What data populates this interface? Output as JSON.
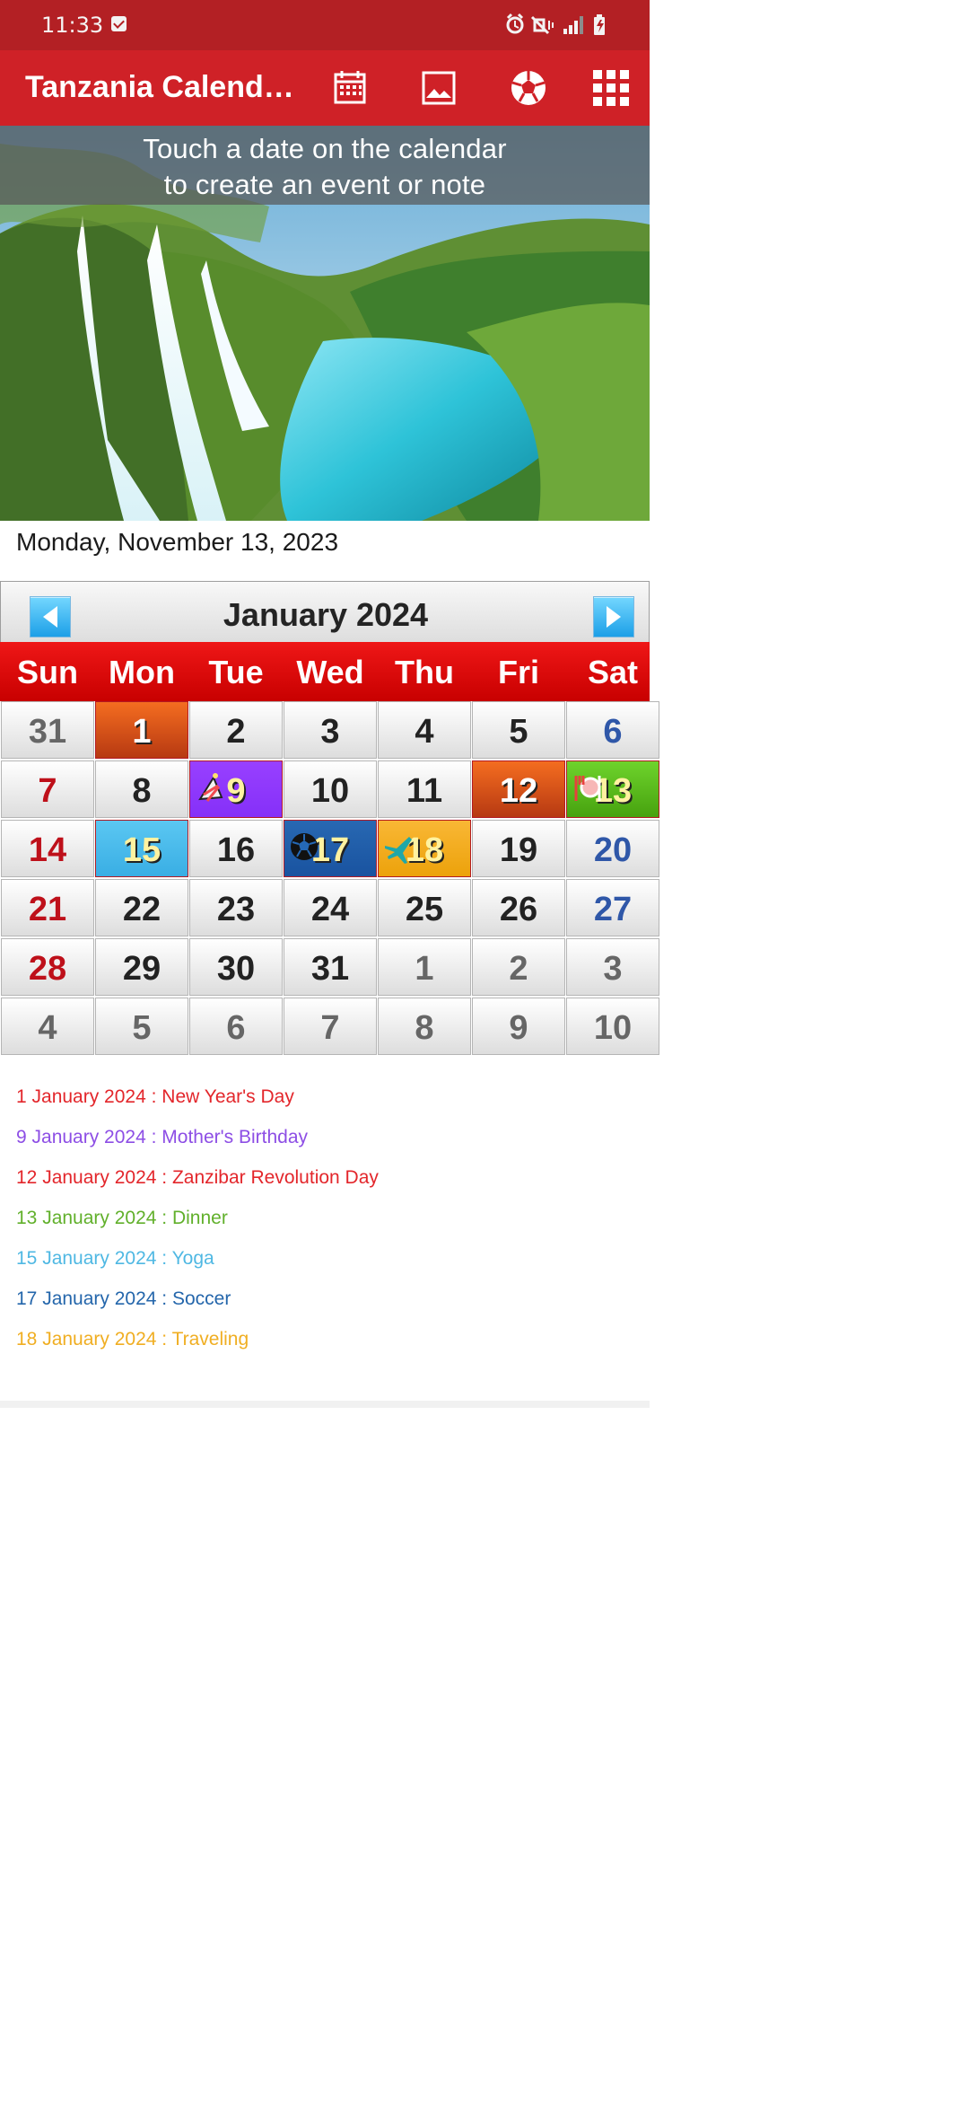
{
  "status_bar": {
    "time": "11:33",
    "icons": [
      "checkbox-icon",
      "alarm-icon",
      "vibrate-mute-icon",
      "signal-icon",
      "battery-charging-icon"
    ]
  },
  "app_bar": {
    "title": "Tanzania Calend…",
    "actions": [
      {
        "name": "calendar-view-icon"
      },
      {
        "name": "image-icon"
      },
      {
        "name": "soccer-ball-icon"
      },
      {
        "name": "grid-menu-icon"
      }
    ]
  },
  "banner": {
    "line1": "Touch a date on the calendar",
    "line2": "to create an event or note"
  },
  "selected_date": "Monday, November 13, 2023",
  "calendar": {
    "month_year": "January  2024",
    "weekdays": [
      "Sun",
      "Mon",
      "Tue",
      "Wed",
      "Thu",
      "Fri",
      "Sat"
    ],
    "weeks": [
      [
        {
          "day": "31",
          "kind": "other"
        },
        {
          "day": "1",
          "kind": "holiday-1"
        },
        {
          "day": "2",
          "kind": "normal"
        },
        {
          "day": "3",
          "kind": "normal"
        },
        {
          "day": "4",
          "kind": "normal"
        },
        {
          "day": "5",
          "kind": "normal"
        },
        {
          "day": "6",
          "kind": "sat"
        }
      ],
      [
        {
          "day": "7",
          "kind": "sun"
        },
        {
          "day": "8",
          "kind": "normal"
        },
        {
          "day": "9",
          "kind": "purple",
          "icon": "party-hat-icon"
        },
        {
          "day": "10",
          "kind": "normal"
        },
        {
          "day": "11",
          "kind": "normal"
        },
        {
          "day": "12",
          "kind": "holiday-12"
        },
        {
          "day": "13",
          "kind": "green",
          "icon": "dinner-icon"
        }
      ],
      [
        {
          "day": "14",
          "kind": "sun"
        },
        {
          "day": "15",
          "kind": "cyan"
        },
        {
          "day": "16",
          "kind": "normal"
        },
        {
          "day": "17",
          "kind": "navy",
          "icon": "soccer-ball-icon"
        },
        {
          "day": "18",
          "kind": "orange",
          "icon": "airplane-icon"
        },
        {
          "day": "19",
          "kind": "normal"
        },
        {
          "day": "20",
          "kind": "sat"
        }
      ],
      [
        {
          "day": "21",
          "kind": "sun"
        },
        {
          "day": "22",
          "kind": "normal"
        },
        {
          "day": "23",
          "kind": "normal"
        },
        {
          "day": "24",
          "kind": "normal"
        },
        {
          "day": "25",
          "kind": "normal"
        },
        {
          "day": "26",
          "kind": "normal"
        },
        {
          "day": "27",
          "kind": "sat"
        }
      ],
      [
        {
          "day": "28",
          "kind": "sun"
        },
        {
          "day": "29",
          "kind": "normal"
        },
        {
          "day": "30",
          "kind": "normal"
        },
        {
          "day": "31",
          "kind": "normal"
        },
        {
          "day": "1",
          "kind": "other"
        },
        {
          "day": "2",
          "kind": "other"
        },
        {
          "day": "3",
          "kind": "other"
        }
      ],
      [
        {
          "day": "4",
          "kind": "other"
        },
        {
          "day": "5",
          "kind": "other"
        },
        {
          "day": "6",
          "kind": "other"
        },
        {
          "day": "7",
          "kind": "other"
        },
        {
          "day": "8",
          "kind": "other"
        },
        {
          "day": "9",
          "kind": "other"
        },
        {
          "day": "10",
          "kind": "other"
        }
      ]
    ]
  },
  "events": [
    {
      "text": "1 January 2024 : New Year's Day",
      "color": "#e3262b"
    },
    {
      "text": "9 January 2024 : Mother's Birthday",
      "color": "#8d4ee5"
    },
    {
      "text": "12 January 2024 : Zanzibar Revolution Day",
      "color": "#e3262b"
    },
    {
      "text": "13 January 2024 : Dinner",
      "color": "#61b02b"
    },
    {
      "text": "15 January 2024 : Yoga",
      "color": "#4fb8e3"
    },
    {
      "text": "17 January 2024 : Soccer",
      "color": "#2466ab"
    },
    {
      "text": "18 January 2024 : Traveling",
      "color": "#f0ae22"
    }
  ]
}
